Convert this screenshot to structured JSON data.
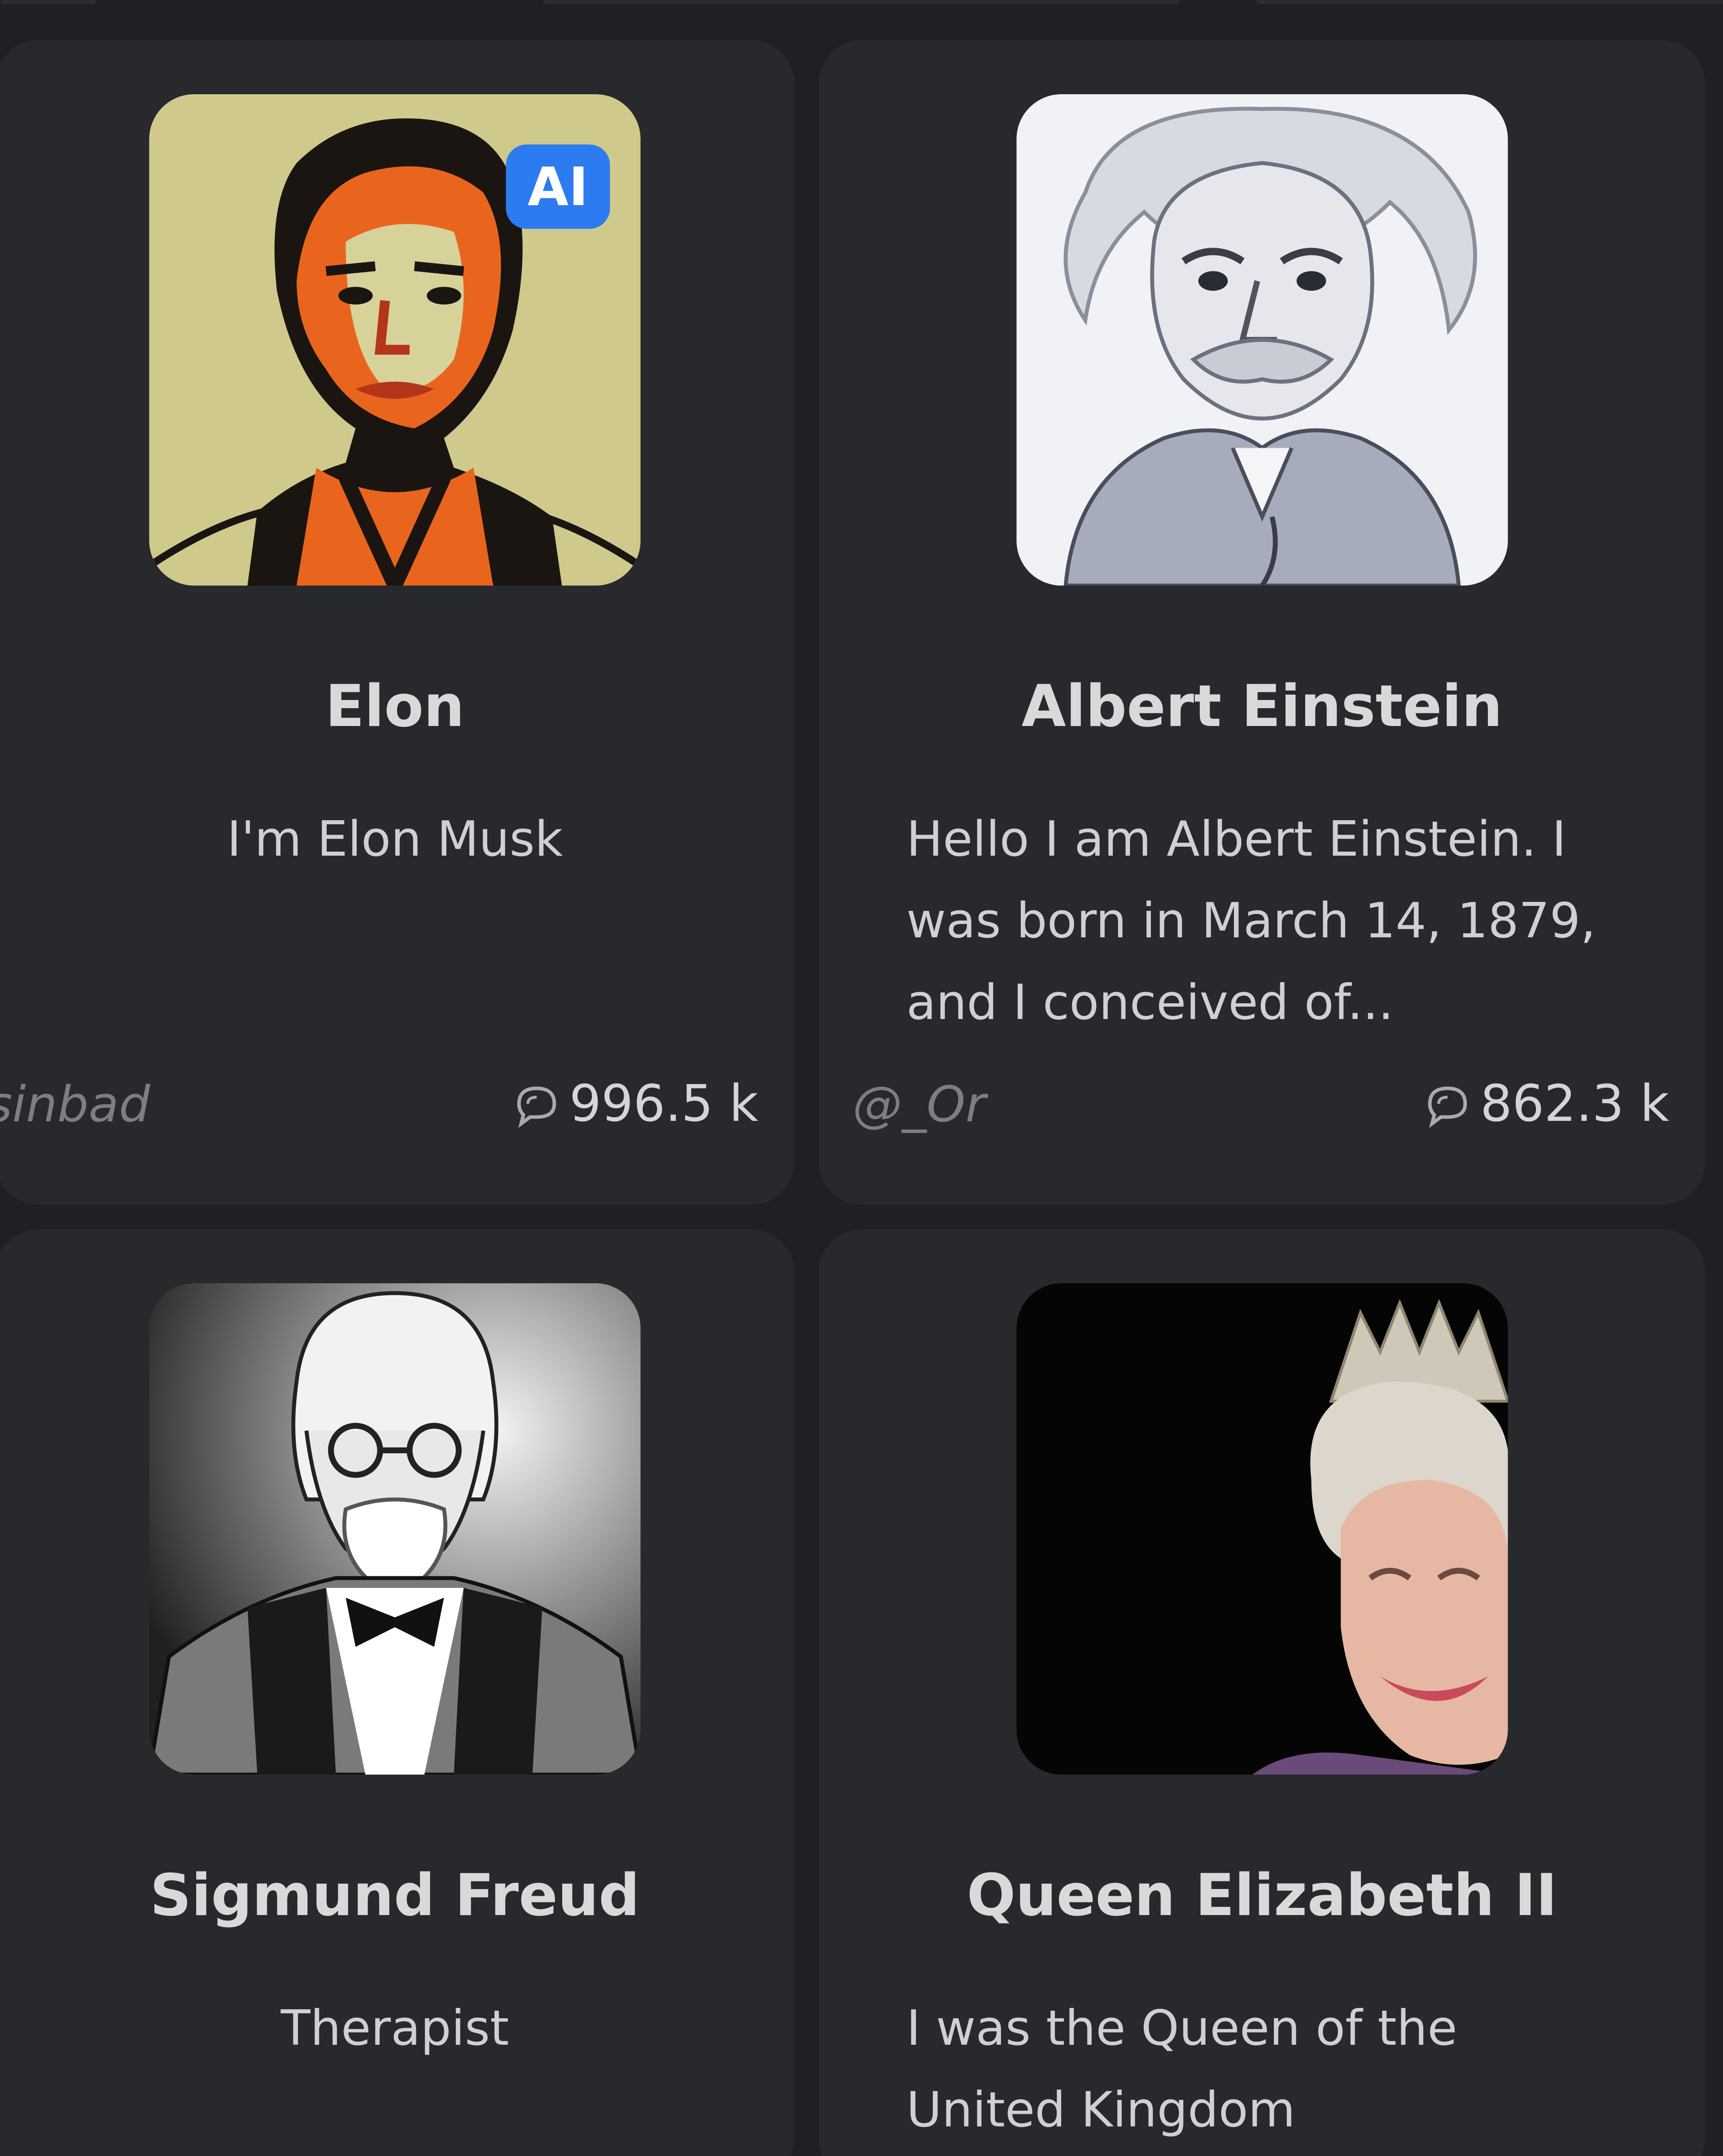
{
  "cards": [
    {
      "name": "Elon",
      "description": "I'm Elon Musk",
      "author": "sinbad",
      "chats": "996.5 k",
      "badge": "AI",
      "avatar_icon": "elon-portrait-icon"
    },
    {
      "name": "Albert Einstein",
      "description": "Hello I am Albert Einstein. I was born in March 14, 1879, and I conceived of...",
      "author": "@_Or",
      "chats": "862.3 k",
      "avatar_icon": "einstein-portrait-icon"
    },
    {
      "name": "Sigmund Freud",
      "description": "Therapist",
      "avatar_icon": "freud-portrait-icon"
    },
    {
      "name": "Queen Elizabeth II",
      "description": "I was the Queen of the United Kingdom",
      "avatar_icon": "queen-portrait-icon"
    }
  ],
  "colors": {
    "background": "#1f2023",
    "card": "#28292c",
    "badge": "#2d7bf0",
    "text_primary": "#d9d9dc",
    "text_muted": "#7d7e83"
  }
}
